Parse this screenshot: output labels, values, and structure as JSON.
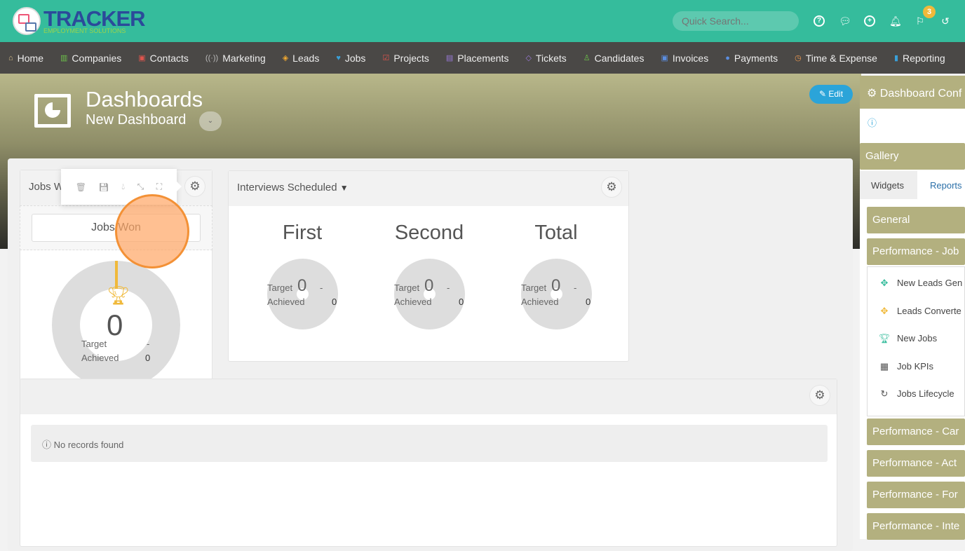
{
  "brand": {
    "name": "TRACKER",
    "tagline": "EMPLOYMENT SOLUTIONS"
  },
  "search": {
    "placeholder": "Quick Search..."
  },
  "header_icons": [
    "help-icon",
    "chat-icon",
    "add-icon",
    "bell-icon",
    "flag-icon",
    "history-icon"
  ],
  "notifications_count": "3",
  "nav": [
    {
      "label": "Home",
      "icon": "home-icon",
      "color": "#d9c08a",
      "g": "⌂"
    },
    {
      "label": "Companies",
      "icon": "building-icon",
      "color": "#6cc04a",
      "g": "▥"
    },
    {
      "label": "Contacts",
      "icon": "contact-icon",
      "color": "#e0554d",
      "g": "▣"
    },
    {
      "label": "Marketing",
      "icon": "broadcast-icon",
      "color": "#bbb",
      "g": "((·))"
    },
    {
      "label": "Leads",
      "icon": "target-icon",
      "color": "#f0a830",
      "g": "◈"
    },
    {
      "label": "Jobs",
      "icon": "trophy-icon",
      "color": "#3aa0d8",
      "g": "♥"
    },
    {
      "label": "Projects",
      "icon": "checkbox-icon",
      "color": "#e0554d",
      "g": "☑"
    },
    {
      "label": "Placements",
      "icon": "briefcase-icon",
      "color": "#9a7ad8",
      "g": "▤"
    },
    {
      "label": "Tickets",
      "icon": "tag-icon",
      "color": "#9a7ad8",
      "g": "◇"
    },
    {
      "label": "Candidates",
      "icon": "person-icon",
      "color": "#6cc04a",
      "g": "♙"
    },
    {
      "label": "Invoices",
      "icon": "invoice-icon",
      "color": "#5b8ee0",
      "g": "▣"
    },
    {
      "label": "Payments",
      "icon": "coins-icon",
      "color": "#5b8ee0",
      "g": "●"
    },
    {
      "label": "Time & Expense",
      "icon": "clock-icon",
      "color": "#f09a50",
      "g": "◷"
    },
    {
      "label": "Reporting",
      "icon": "bar-chart-icon",
      "color": "#3aa0d8",
      "g": "▮"
    }
  ],
  "hero": {
    "title": "Dashboards",
    "subtitle": "New Dashboard",
    "edit_label": "Edit"
  },
  "widgets": {
    "jobs_won": {
      "title": "Jobs W",
      "title_input": "Jobs Won",
      "value": "0",
      "target_label": "Target",
      "target_value": "-",
      "achieved_label": "Achieved",
      "achieved_value": "0"
    },
    "interviews": {
      "title": "Interviews Scheduled",
      "columns": [
        {
          "heading": "First",
          "value": "0",
          "target_label": "Target",
          "target_value": "-",
          "achieved_label": "Achieved",
          "achieved_value": "0"
        },
        {
          "heading": "Second",
          "value": "0",
          "target_label": "Target",
          "target_value": "-",
          "achieved_label": "Achieved",
          "achieved_value": "0"
        },
        {
          "heading": "Total",
          "value": "0",
          "target_label": "Target",
          "target_value": "-",
          "achieved_label": "Achieved",
          "achieved_value": "0"
        }
      ]
    },
    "records": {
      "empty_message": "No records found"
    }
  },
  "side_panel": {
    "title": "Dashboard Conf",
    "gallery": "Gallery",
    "tabs": [
      "Widgets",
      "Reports"
    ],
    "groups": [
      "General",
      "Performance - Job",
      "Performance - Car",
      "Performance - Act",
      "Performance - For",
      "Performance - Inte"
    ],
    "items": [
      {
        "label": "New Leads Gen",
        "icon": "leads-icon",
        "color": "#35bc9c"
      },
      {
        "label": "Leads Converte",
        "icon": "leads-converted-icon",
        "color": "#f0b93a"
      },
      {
        "label": "New Jobs",
        "icon": "trophy-icon",
        "color": "#35bc9c"
      },
      {
        "label": "Job KPIs",
        "icon": "table-icon",
        "color": "#555"
      },
      {
        "label": "Jobs Lifecycle",
        "icon": "cycle-icon",
        "color": "#555"
      }
    ]
  }
}
